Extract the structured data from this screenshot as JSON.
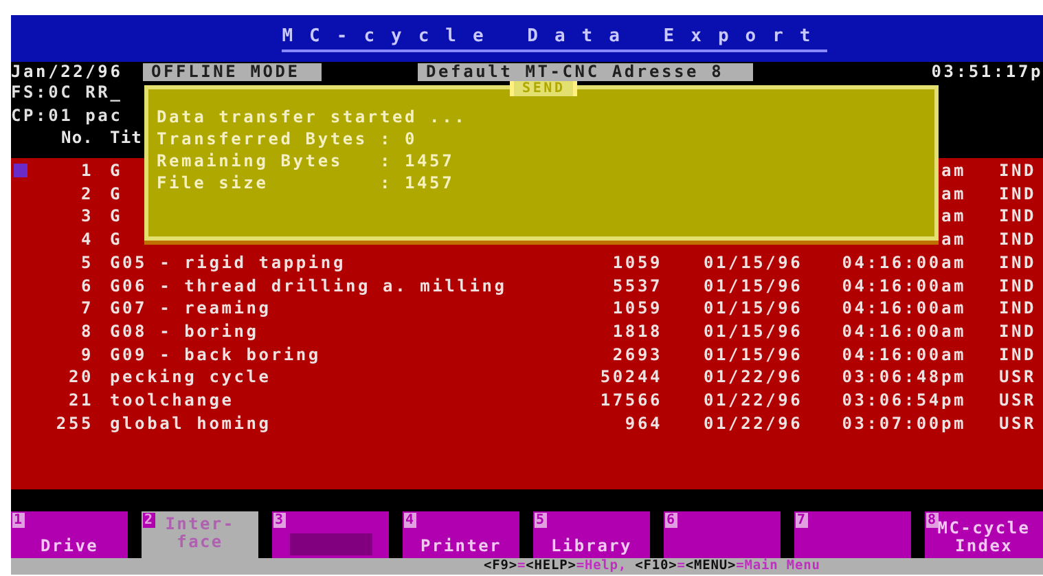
{
  "title": "MC-cycle Data Export",
  "status": {
    "date": "Jan/22/96",
    "mode": "OFFLINE MODE",
    "address": "Default MT-CNC Adresse 8",
    "time": "03:51:17p"
  },
  "info_lines": [
    "FS:0C RR_",
    "CP:01 pac"
  ],
  "table": {
    "columns": [
      "No.",
      "Tit"
    ],
    "rows": [
      {
        "no": "1",
        "title": "G",
        "time": "am",
        "type": "IND",
        "selected": true
      },
      {
        "no": "2",
        "title": "G",
        "time": "am",
        "type": "IND",
        "selected": false
      },
      {
        "no": "3",
        "title": "G",
        "time": "am",
        "type": "IND",
        "selected": false
      },
      {
        "no": "4",
        "title": "G",
        "time": "am",
        "type": "IND",
        "selected": false
      },
      {
        "no": "5",
        "title": "G05 - rigid tapping",
        "size": "1059",
        "date": "01/15/96",
        "time": "04:16:00am",
        "type": "IND",
        "selected": false
      },
      {
        "no": "6",
        "title": "G06 - thread drilling a. milling",
        "size": "5537",
        "date": "01/15/96",
        "time": "04:16:00am",
        "type": "IND",
        "selected": false
      },
      {
        "no": "7",
        "title": "G07 - reaming",
        "size": "1059",
        "date": "01/15/96",
        "time": "04:16:00am",
        "type": "IND",
        "selected": false
      },
      {
        "no": "8",
        "title": "G08 - boring",
        "size": "1818",
        "date": "01/15/96",
        "time": "04:16:00am",
        "type": "IND",
        "selected": false
      },
      {
        "no": "9",
        "title": "G09 - back boring",
        "size": "2693",
        "date": "01/15/96",
        "time": "04:16:00am",
        "type": "IND",
        "selected": false
      },
      {
        "no": "20",
        "title": "pecking cycle",
        "size": "50244",
        "date": "01/22/96",
        "time": "03:06:48pm",
        "type": "USR",
        "selected": false
      },
      {
        "no": "21",
        "title": "toolchange",
        "size": "17566",
        "date": "01/22/96",
        "time": "03:06:54pm",
        "type": "USR",
        "selected": false
      },
      {
        "no": "255",
        "title": "global homing",
        "size": "964",
        "date": "01/22/96",
        "time": "03:07:00pm",
        "type": "USR",
        "selected": false
      }
    ]
  },
  "dialog": {
    "title": "SEND",
    "lines": [
      "Data transfer started ...",
      "Transferred Bytes : 0",
      "Remaining Bytes   : 1457",
      "File size         : 1457"
    ]
  },
  "function_keys": [
    {
      "number": "1",
      "label": "Drive",
      "selected": false,
      "kind": "text"
    },
    {
      "number": "2",
      "label": "Inter-face",
      "selected": true,
      "kind": "text"
    },
    {
      "number": "3",
      "selected": false,
      "kind": "block"
    },
    {
      "number": "4",
      "label": "Printer",
      "selected": false,
      "kind": "text"
    },
    {
      "number": "5",
      "label": "Library",
      "selected": false,
      "kind": "text"
    },
    {
      "number": "6",
      "selected": false,
      "kind": "empty"
    },
    {
      "number": "7",
      "selected": false,
      "kind": "empty"
    },
    {
      "number": "8",
      "label": "MC-cycle Index",
      "selected": false,
      "kind": "text"
    }
  ],
  "help_line": [
    {
      "text": "<F9>",
      "kind": "key"
    },
    {
      "text": "=",
      "kind": "desc"
    },
    {
      "text": "<HELP>",
      "kind": "key"
    },
    {
      "text": "=Help, ",
      "kind": "desc"
    },
    {
      "text": "<F10>",
      "kind": "key"
    },
    {
      "text": "=",
      "kind": "desc"
    },
    {
      "text": "<MENU>",
      "kind": "key"
    },
    {
      "text": "=Main Menu",
      "kind": "desc"
    }
  ]
}
